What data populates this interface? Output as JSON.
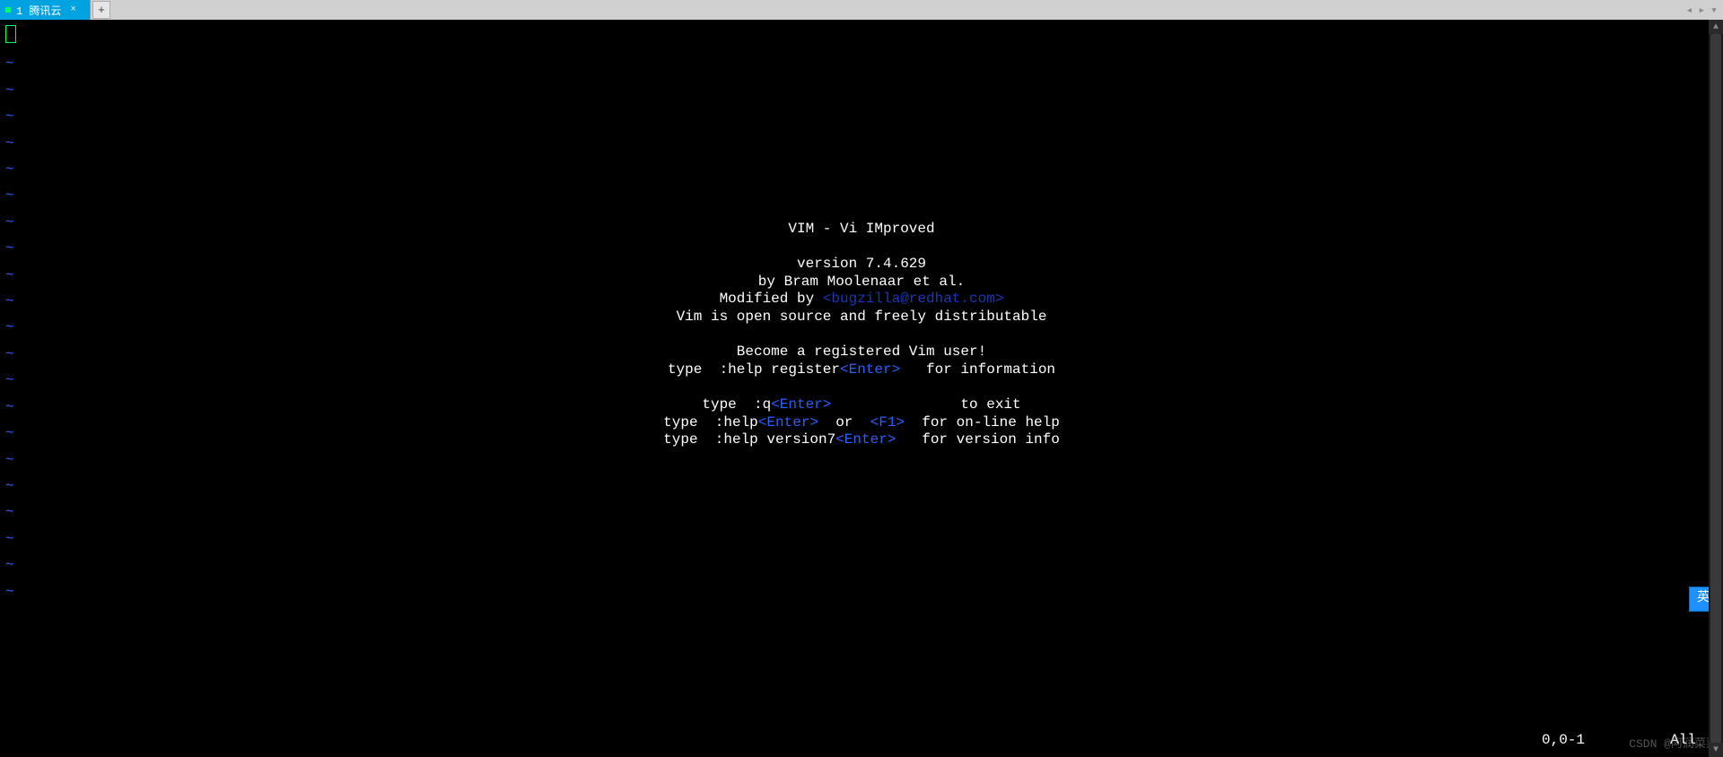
{
  "tabbar": {
    "tab_label": "1 腾讯云",
    "tab_close_glyph": "×",
    "newtab_glyph": "+",
    "nav_prev_glyph": "◂",
    "nav_next_glyph": "▸",
    "menu_glyph": "▾"
  },
  "gutter": {
    "tilde": "~",
    "count": 21
  },
  "intro": {
    "title": "VIM - Vi IMproved",
    "blank": "",
    "version": "version 7.4.629",
    "author": "by Bram Moolenaar et al.",
    "modified_prefix": "Modified by ",
    "modified_email": "<bugzilla@redhat.com>",
    "oss": "Vim is open source and freely distributable",
    "become": "Become a registered Vim user!",
    "reg_pre": "type  :help register",
    "reg_key": "<Enter>",
    "reg_post": "   for information",
    "quit_pre": "type  :q",
    "quit_key": "<Enter>",
    "quit_post": "               to exit",
    "help_pre": "type  :help",
    "help_key": "<Enter>",
    "help_mid": "  or  ",
    "help_key2": "<F1>",
    "help_post": "  for on-line help",
    "ver_pre": "type  :help version7",
    "ver_key": "<Enter>",
    "ver_post": "   for version info"
  },
  "ruler": {
    "pos": "0,0-1"
  },
  "allpos": "All",
  "ime": {
    "label": "英"
  },
  "watermark": "CSDN @阿润菜菜",
  "scroll": {
    "up_glyph": "▲",
    "down_glyph": "▼"
  }
}
